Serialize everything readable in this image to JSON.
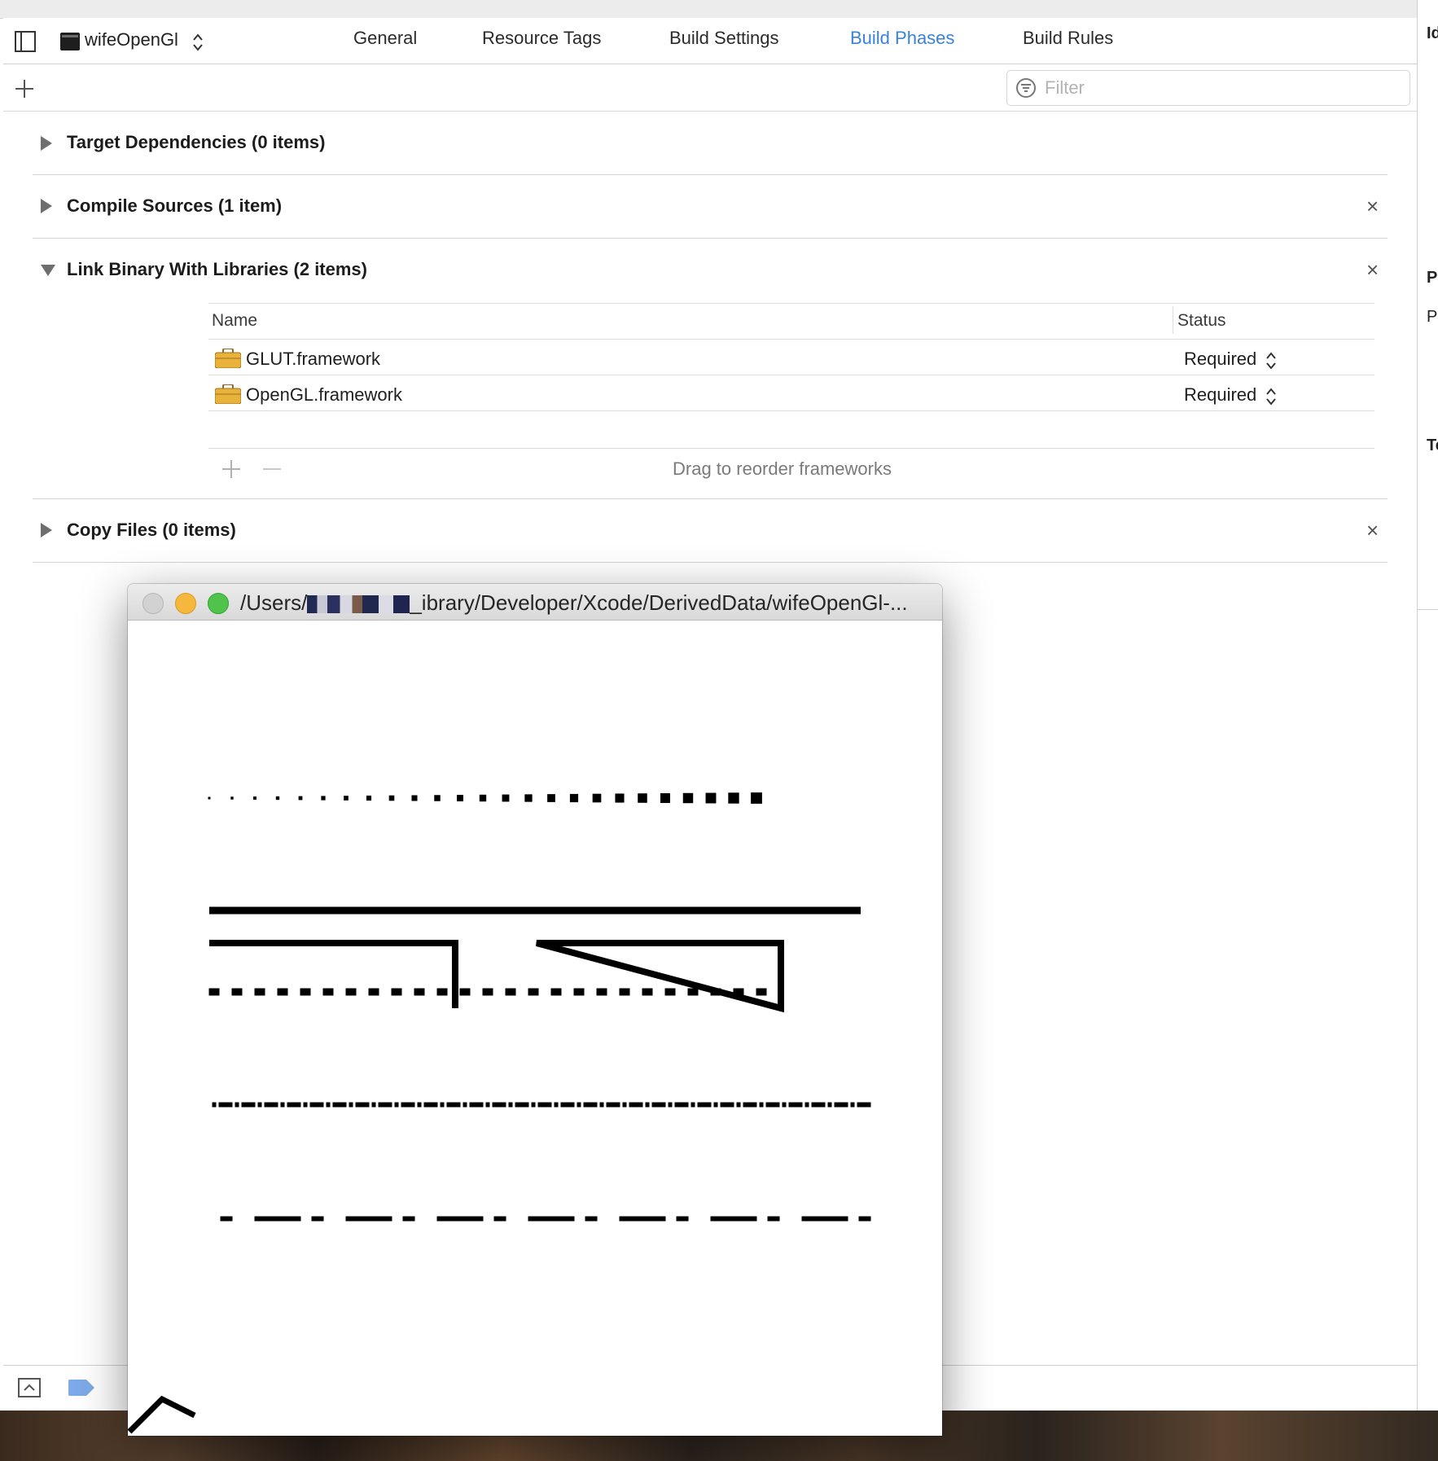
{
  "tabbar": {
    "target_name": "wifeOpenGl",
    "tabs": [
      "General",
      "Resource Tags",
      "Build Settings",
      "Build Phases",
      "Build Rules"
    ],
    "active_tab": "Build Phases"
  },
  "filter": {
    "placeholder": "Filter"
  },
  "phases": {
    "target_dependencies": "Target Dependencies (0 items)",
    "compile_sources": "Compile Sources (1 item)",
    "link_binary": "Link Binary With Libraries (2 items)",
    "copy_files": "Copy Files (0 items)"
  },
  "libraries": {
    "columns": {
      "name": "Name",
      "status": "Status"
    },
    "rows": [
      {
        "name": "GLUT.framework",
        "status": "Required"
      },
      {
        "name": "OpenGL.framework",
        "status": "Required"
      }
    ],
    "drag_hint": "Drag to reorder frameworks"
  },
  "gl_window": {
    "title_prefix": "/Users/",
    "title_suffix": "_ibrary/Developer/Xcode/DerivedData/wifeOpenGl-..."
  },
  "inspector": {
    "labels": [
      "Id",
      "Pr",
      "P",
      "Te"
    ]
  },
  "colors": {
    "accent": "#3a82d9",
    "traffic_close": "#cfcfcf",
    "traffic_minimize": "#f5b83d",
    "traffic_zoom": "#4fc34a",
    "framework_icon": "#e9b23a"
  },
  "icons": [
    "sidebar-toggle-icon",
    "terminal-target-icon",
    "stepper-arrows-icon",
    "plus-icon",
    "filter-icon",
    "disclosure-triangle-icon",
    "close-icon",
    "framework-toolbox-icon",
    "minus-icon",
    "tag-icon",
    "panel-icon"
  ]
}
